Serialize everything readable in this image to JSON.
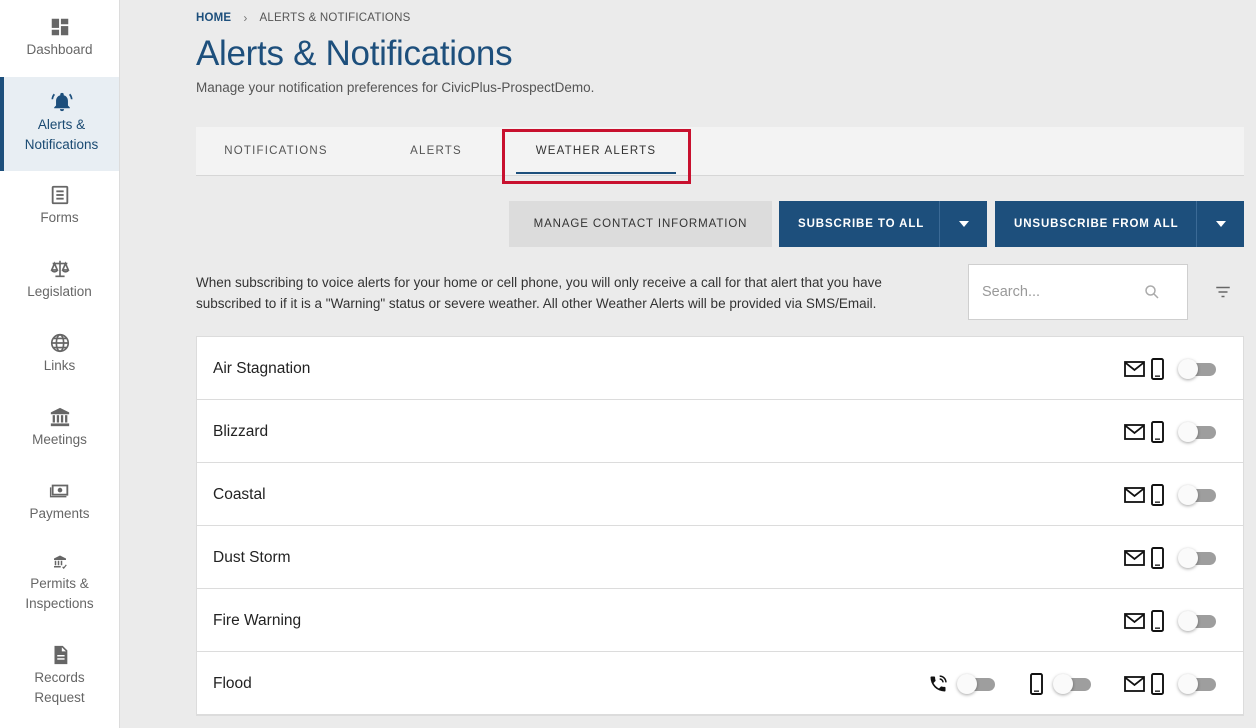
{
  "sidebar": {
    "items": [
      {
        "label": "Dashboard",
        "icon": "dashboard-icon"
      },
      {
        "label": "Alerts & Notifications",
        "icon": "bell-icon",
        "active": true
      },
      {
        "label": "Forms",
        "icon": "form-icon"
      },
      {
        "label": "Legislation",
        "icon": "scales-icon"
      },
      {
        "label": "Links",
        "icon": "globe-icon"
      },
      {
        "label": "Meetings",
        "icon": "building-icon"
      },
      {
        "label": "Payments",
        "icon": "money-icon"
      },
      {
        "label": "Permits & Inspections",
        "icon": "permit-icon"
      },
      {
        "label": "Records Request",
        "icon": "document-icon"
      }
    ]
  },
  "breadcrumb": {
    "home": "HOME",
    "separator": "›",
    "current": "ALERTS & NOTIFICATIONS"
  },
  "page": {
    "title": "Alerts & Notifications",
    "subtitle": "Manage your notification preferences for CivicPlus-ProspectDemo."
  },
  "tabs": [
    {
      "label": "NOTIFICATIONS",
      "active": false
    },
    {
      "label": "ALERTS",
      "active": false
    },
    {
      "label": "WEATHER ALERTS",
      "active": true
    }
  ],
  "actions": {
    "manage_contact": "MANAGE CONTACT INFORMATION",
    "subscribe_all": "SUBSCRIBE TO ALL",
    "unsubscribe_all": "UNSUBSCRIBE FROM ALL"
  },
  "info_text": "When subscribing to voice alerts for your home or cell phone, you will only receive a call for that alert that you have subscribed to if it is a \"Warning\" status or severe weather. All other Weather Alerts will be provided via SMS/Email.",
  "search": {
    "placeholder": "Search..."
  },
  "weather_alerts": [
    {
      "name": "Air Stagnation",
      "channels": [
        "email-sms"
      ],
      "subscribed": [
        false
      ]
    },
    {
      "name": "Blizzard",
      "channels": [
        "email-sms"
      ],
      "subscribed": [
        false
      ]
    },
    {
      "name": "Coastal",
      "channels": [
        "email-sms"
      ],
      "subscribed": [
        false
      ]
    },
    {
      "name": "Dust Storm",
      "channels": [
        "email-sms"
      ],
      "subscribed": [
        false
      ]
    },
    {
      "name": "Fire Warning",
      "channels": [
        "email-sms"
      ],
      "subscribed": [
        false
      ]
    },
    {
      "name": "Flood",
      "channels": [
        "voice",
        "sms",
        "email-sms"
      ],
      "subscribed": [
        false,
        false,
        false
      ]
    }
  ],
  "colors": {
    "brand": "#1d4f7c",
    "highlight": "#c8102e",
    "toggle_off": "#9e9e9e"
  }
}
